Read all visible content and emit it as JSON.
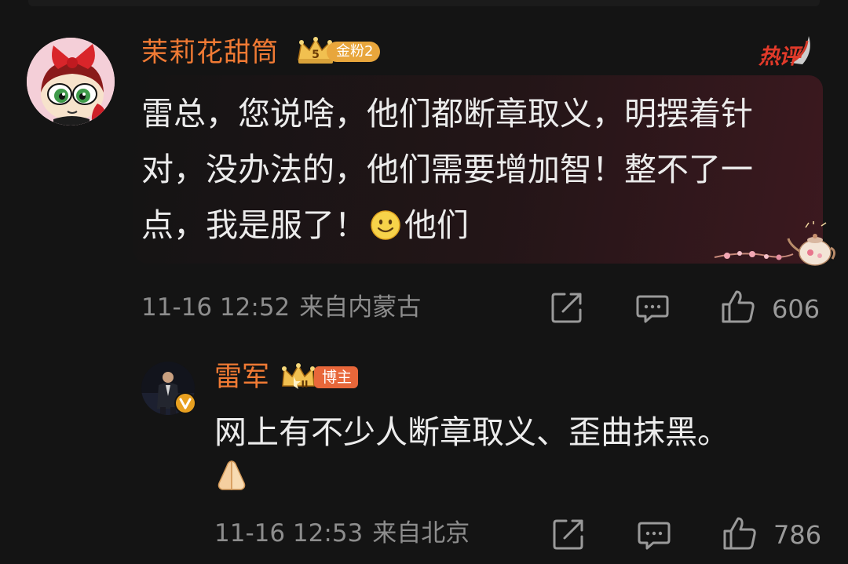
{
  "comment": {
    "username": "茉莉花甜筒",
    "fan_badge": {
      "level_digit": "5",
      "label": "金粉2"
    },
    "hot_badge": "热评",
    "content_text": "雷总，您说啥，他们都断章取义，明摆着针对，没办法的，他们需要增加智！整不了一点，我是服了！",
    "content_tail": "他们",
    "emoji": "smile-emoji",
    "time": "11-16 12:52",
    "location": "来自内蒙古",
    "like_count": "606"
  },
  "reply": {
    "username": "雷军",
    "crown_level": "II",
    "badge_label": "博主",
    "content": "网上有不少人断章取义、歪曲抹黑。",
    "emoji": "folded-hands-emoji",
    "time": "11-16 12:53",
    "location": "来自北京",
    "like_count": "786"
  },
  "colors": {
    "background": "#141414",
    "username": "#f07a34",
    "meta": "#8d8d8d",
    "fan_badge": "#e8a63c",
    "blogger_badge": "#e8673a",
    "hot_badge": "#e23a2a",
    "verified": "#e8a020"
  }
}
